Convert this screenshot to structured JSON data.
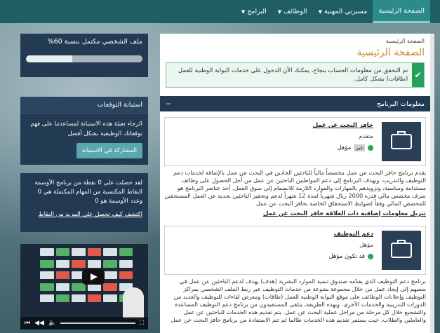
{
  "nav": {
    "items": [
      {
        "label": "الصفحة الرئيسية",
        "active": true,
        "caret": false
      },
      {
        "label": "مسيرتي المهنية",
        "active": false,
        "caret": true
      },
      {
        "label": "الوظائف",
        "active": false,
        "caret": true
      },
      {
        "label": "البرامج",
        "active": false,
        "caret": true
      }
    ]
  },
  "sidebar": {
    "profile": {
      "title": "ملف الشخصي مكتمل بنسبة 60%",
      "progress_percent": 60
    },
    "survey": {
      "title": "استبانة التوقعات",
      "text": "الرجاء تعبئة هذه الاستبانة لمساعدتنا على فهم توقعاتك الوظيفية بشكل أفضل",
      "button": "المشاركة في الاستبانة"
    },
    "points": {
      "line1": "لقد حصلت على 0 نقطة من برنامج الأوسمة",
      "line2": "النقاط المكتسبة من المهام المكتملة هي 0 وعدد الأوسمة هو 0",
      "link": "اكتشف كيف تحصل على المزيد من النقاط"
    },
    "video": {
      "tag": "YOU"
    }
  },
  "main": {
    "breadcrumb": "الصفحة الرئيسية",
    "title": "الصفحة الرئيسية",
    "alert": "تم التحقق من معلومات الحساب بنجاح، يمكنك الآن الدخول على خدمات البوابة الوطنية للعمل (طاقات) بشكل كامل.",
    "section_title": "معلومات البرنامج",
    "section_toggle": "−",
    "programs": [
      {
        "name": "حافز البحث عن عمل",
        "status": "متقدم",
        "eligibility": "مؤهل",
        "badge": "غير",
        "description": "يقدم برنامج حافز البحث عن عمل مخصصاً مالياً للباحثين الجادين في البحث عن عمل بالإضافة لخدمات دعم التوظيف والتدريب. ويهدف البرنامج إلى دعم المواطنين الباحثين عن عمل من أجل الحصول على وظائف مستدامة ومناسبة، وتزويدهم بالمهارات والموارد اللازمة للانضمام إلى سوق العمل. أحد عناصر البرنامج هو صرف مخصص مالي قدره 2000 ريال شهرياً لمدة 12 شهراً لدعم وتحفيز الباحثين بجدية عن العمل المستحقين للمخصص المالي وفقاً لضوابط الاستحقاق الخاصة بحافز البحث عن عمل",
        "related": "تنزيل معلومات إضافية ذات العلاقة حافز البحث عن عمل"
      },
      {
        "name": "دعم التوظيف",
        "status": "مؤهل",
        "eligibility": "قد تكون مؤهل",
        "badge": "",
        "description": "برنامج دعم التوظيف الذي يقدّمه صندوق تنمية الموارد البشرية (هدف) يهدف لدعم الباحثين عن عمل في سعيهم إلى إيجاد عمل من خلال مجموعة متنوعة من خدمات التوظيف عبر ربط الملف الشخصي بمراكز التوظيف وإعلانات الوظائف على موقع البوابة الوطنية للعمل (طاقات) ومعرض لقاءات للتوظيف والعديد من الدورات التدريبية والخدمات الأخرى. وبهذه الطريقة، يتلقى المستفيدون من برنامج دعم التوظيف المساعدة والتشجيع خلال كل مرحلة من مراحل عملية البحث عن عمل. يتم تقديم هذه الخدمات للباحثين عن عمل والعاملين والطلاب، حيث يستمر تقديم هذه الخدمات طالما لم تتم الاستفادة من برنامج حافز البحث عن عمل"
      }
    ]
  },
  "colors": {
    "nav_bg": "#1f5f63",
    "nav_active": "#2c8a8a",
    "sidebar_bg": "#223a52",
    "title_gold": "#c78a2d",
    "success": "#23a05b"
  }
}
